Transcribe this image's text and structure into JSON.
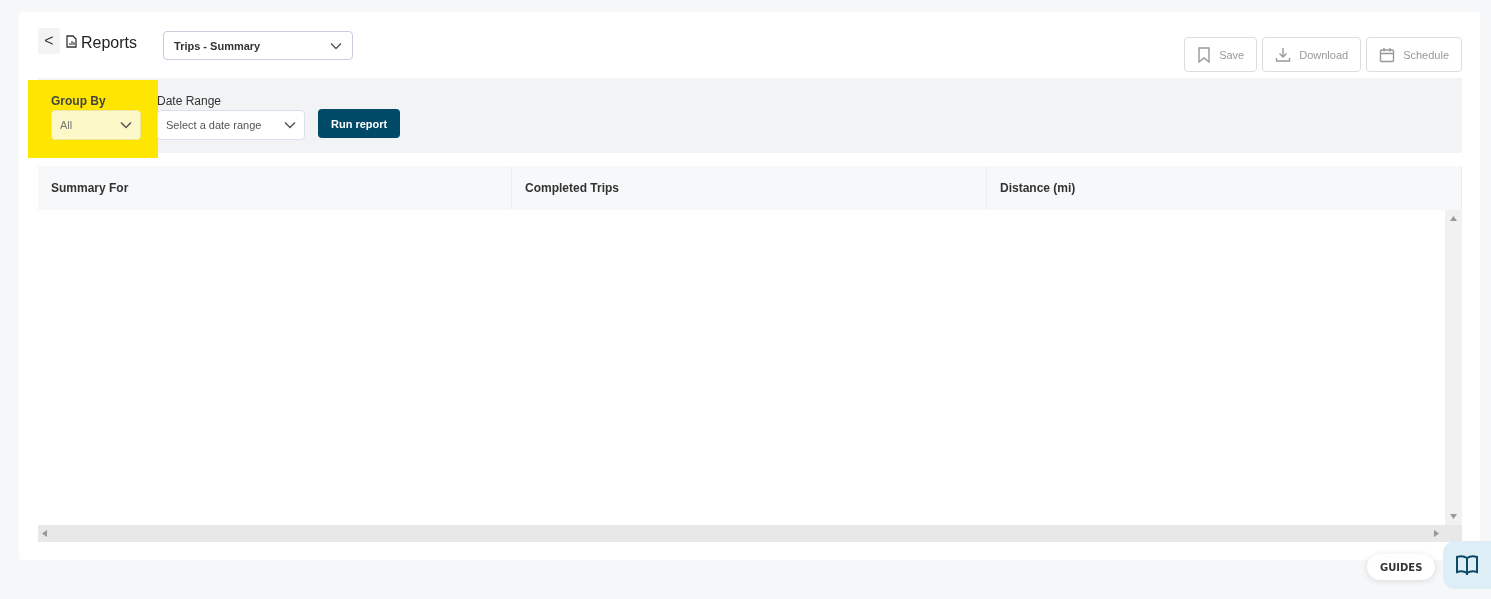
{
  "header": {
    "back": "<",
    "title": "Reports",
    "report_select": {
      "value": "Trips - Summary"
    },
    "actions": [
      {
        "label": "Save",
        "kind": "bookmark",
        "disabled": true
      },
      {
        "label": "Download",
        "kind": "download",
        "disabled": true
      },
      {
        "label": "Schedule",
        "kind": "calendar",
        "disabled": true
      }
    ]
  },
  "filters": {
    "group_by": {
      "label": "Group By",
      "value": "All",
      "highlighted": true
    },
    "date_range": {
      "label": "Date Range",
      "placeholder": "Select a date range"
    },
    "run_button": "Run report"
  },
  "table": {
    "columns": [
      "Summary For",
      "Completed Trips",
      "Distance (mi)"
    ]
  },
  "guides": {
    "label": "GUIDES"
  }
}
